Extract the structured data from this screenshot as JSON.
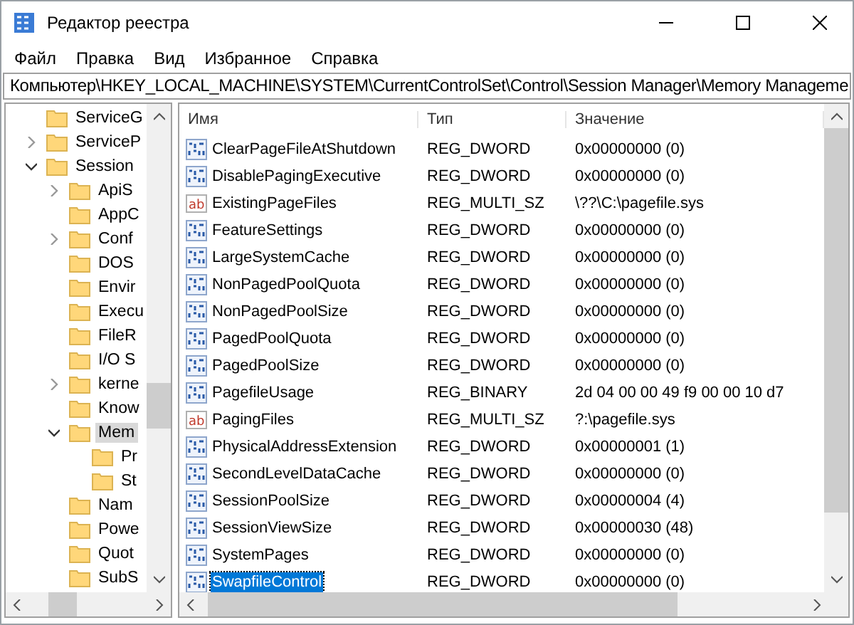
{
  "window": {
    "title": "Редактор реестра"
  },
  "menu": [
    "Файл",
    "Правка",
    "Вид",
    "Избранное",
    "Справка"
  ],
  "address": "Компьютер\\HKEY_LOCAL_MACHINE\\SYSTEM\\CurrentControlSet\\Control\\Session Manager\\Memory Manageme",
  "tree": [
    {
      "label": "ServiceG",
      "selected": false
    },
    {
      "label": "ServiceP",
      "selected": false,
      "expanded": false
    },
    {
      "label": "Session",
      "selected": false,
      "expanded": true,
      "children": [
        {
          "label": "ApiS",
          "selected": false,
          "expanded": false
        },
        {
          "label": "AppC",
          "selected": false
        },
        {
          "label": "Conf",
          "selected": false,
          "expanded": false
        },
        {
          "label": "DOS",
          "selected": false
        },
        {
          "label": "Envir",
          "selected": false
        },
        {
          "label": "Execu",
          "selected": false
        },
        {
          "label": "FileR",
          "selected": false
        },
        {
          "label": "I/O S",
          "selected": false
        },
        {
          "label": "kerne",
          "selected": false,
          "expanded": false
        },
        {
          "label": "Know",
          "selected": false
        },
        {
          "label": "Mem",
          "selected": true,
          "expanded": true,
          "children": [
            {
              "label": "Pr",
              "selected": false
            },
            {
              "label": "St",
              "selected": false
            }
          ]
        },
        {
          "label": "Nam",
          "selected": false
        },
        {
          "label": "Powe",
          "selected": false
        },
        {
          "label": "Quot",
          "selected": false
        },
        {
          "label": "SubS",
          "selected": false
        }
      ]
    }
  ],
  "table": {
    "columns": [
      "Имя",
      "Тип",
      "Значение"
    ],
    "rows": [
      {
        "kind": "binary",
        "name": "ClearPageFileAtShutdown",
        "type": "REG_DWORD",
        "value": "0x00000000 (0)",
        "selected": false
      },
      {
        "kind": "binary",
        "name": "DisablePagingExecutive",
        "type": "REG_DWORD",
        "value": "0x00000000 (0)",
        "selected": false
      },
      {
        "kind": "string",
        "icon": "ab",
        "name": "ExistingPageFiles",
        "type": "REG_MULTI_SZ",
        "value": "\\??\\C:\\pagefile.sys",
        "selected": false
      },
      {
        "kind": "binary",
        "name": "FeatureSettings",
        "type": "REG_DWORD",
        "value": "0x00000000 (0)",
        "selected": false
      },
      {
        "kind": "binary",
        "name": "LargeSystemCache",
        "type": "REG_DWORD",
        "value": "0x00000000 (0)",
        "selected": false
      },
      {
        "kind": "binary",
        "name": "NonPagedPoolQuota",
        "type": "REG_DWORD",
        "value": "0x00000000 (0)",
        "selected": false
      },
      {
        "kind": "binary",
        "name": "NonPagedPoolSize",
        "type": "REG_DWORD",
        "value": "0x00000000 (0)",
        "selected": false
      },
      {
        "kind": "binary",
        "name": "PagedPoolQuota",
        "type": "REG_DWORD",
        "value": "0x00000000 (0)",
        "selected": false
      },
      {
        "kind": "binary",
        "name": "PagedPoolSize",
        "type": "REG_DWORD",
        "value": "0x00000000 (0)",
        "selected": false
      },
      {
        "kind": "binary",
        "name": "PagefileUsage",
        "type": "REG_BINARY",
        "value": "2d 04 00 00 49 f9 00 00 10 d7",
        "selected": false
      },
      {
        "kind": "string",
        "icon": "ab",
        "name": "PagingFiles",
        "type": "REG_MULTI_SZ",
        "value": "?:\\pagefile.sys",
        "selected": false
      },
      {
        "kind": "binary",
        "name": "PhysicalAddressExtension",
        "type": "REG_DWORD",
        "value": "0x00000001 (1)",
        "selected": false
      },
      {
        "kind": "binary",
        "name": "SecondLevelDataCache",
        "type": "REG_DWORD",
        "value": "0x00000000 (0)",
        "selected": false
      },
      {
        "kind": "binary",
        "name": "SessionPoolSize",
        "type": "REG_DWORD",
        "value": "0x00000004 (4)",
        "selected": false
      },
      {
        "kind": "binary",
        "name": "SessionViewSize",
        "type": "REG_DWORD",
        "value": "0x00000030 (48)",
        "selected": false
      },
      {
        "kind": "binary",
        "name": "SystemPages",
        "type": "REG_DWORD",
        "value": "0x00000000 (0)",
        "selected": false
      },
      {
        "kind": "binary",
        "name": "SwapfileControl",
        "type": "REG_DWORD",
        "value": "0x00000000 (0)",
        "selected": true
      }
    ]
  }
}
